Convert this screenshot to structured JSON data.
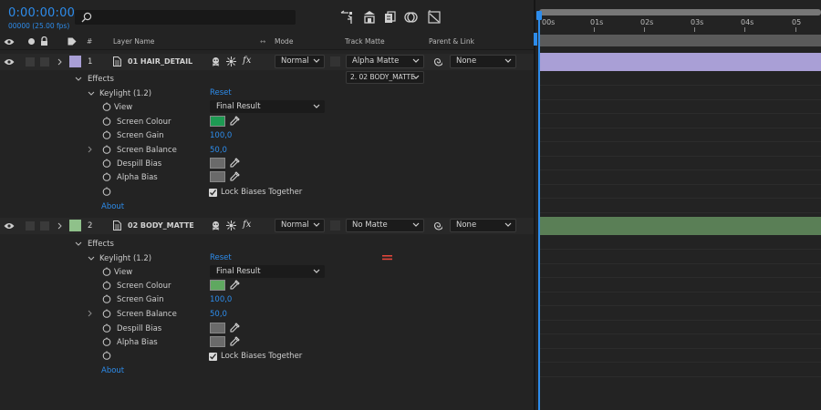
{
  "header": {
    "timecode": "0:00:00:00",
    "fps": "00000 (25.00 fps)"
  },
  "columns": {
    "layer_name": "Layer Name",
    "mode": "Mode",
    "track_matte": "Track Matte",
    "parent_link": "Parent & Link",
    "number": "#"
  },
  "timeline": {
    "ticks": [
      "00s",
      "01s",
      "02s",
      "03s",
      "04s",
      "05"
    ]
  },
  "layers": [
    {
      "number": "1",
      "name": "01 HAIR_DETAIL",
      "label_color": "#a99fd6",
      "bar_color": "#a99fd6",
      "mode": "Normal",
      "track_matte": "Alpha Matte",
      "matte_layer": "2. 02 BODY_MATTE",
      "parent": "None",
      "effects_label": "Effects",
      "effect_name": "Keylight (1.2)",
      "reset": "Reset",
      "props": {
        "view": "View",
        "view_value": "Final Result",
        "screen_colour": "Screen Colour",
        "screen_colour_value": "#1e9a53",
        "screen_gain": "Screen Gain",
        "screen_gain_value": "100,0",
        "screen_balance": "Screen Balance",
        "screen_balance_value": "50,0",
        "despill_bias": "Despill Bias",
        "alpha_bias": "Alpha Bias",
        "lock_biases": "Lock Biases Together"
      },
      "about": "About"
    },
    {
      "number": "2",
      "name": "02 BODY_MATTE",
      "label_color": "#8fc18a",
      "bar_color": "#5a7f56",
      "mode": "Normal",
      "track_matte": "No Matte",
      "parent": "None",
      "effects_label": "Effects",
      "effect_name": "Keylight (1.2)",
      "reset": "Reset",
      "props": {
        "view": "View",
        "view_value": "Final Result",
        "screen_colour": "Screen Colour",
        "screen_colour_value": "#5fa860",
        "screen_gain": "Screen Gain",
        "screen_gain_value": "100,0",
        "screen_balance": "Screen Balance",
        "screen_balance_value": "50,0",
        "despill_bias": "Despill Bias",
        "alpha_bias": "Alpha Bias",
        "lock_biases": "Lock Biases Together"
      },
      "about": "About"
    }
  ],
  "colors": {
    "accent": "#2d8ceb",
    "warning": "#e0463a"
  }
}
